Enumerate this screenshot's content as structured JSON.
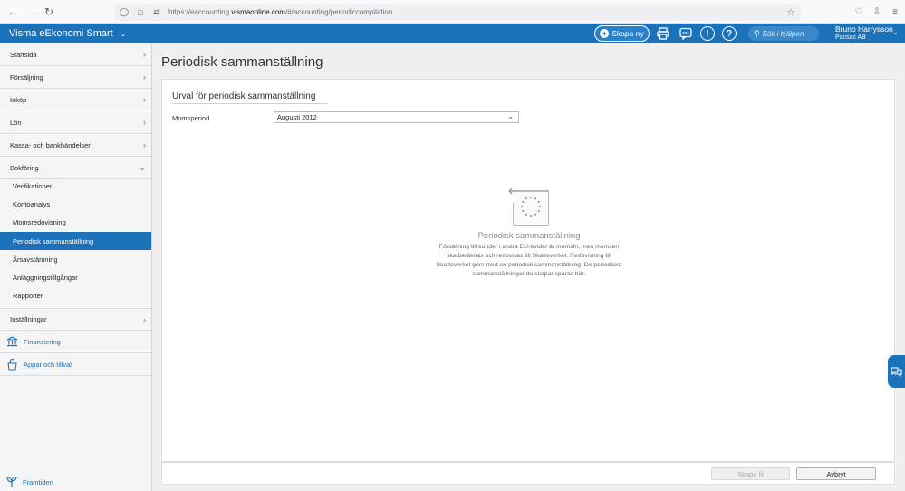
{
  "browser": {
    "url_prefix": "https://eaccounting.",
    "url_domain": "vismaonline.com",
    "url_path": "/#/accounting/periodiccompilation"
  },
  "header": {
    "app_name": "Visma eEkonomi Smart",
    "create_label": "Skapa ny",
    "search_placeholder": "Sök i hjälpen",
    "user_name": "Bruno Harrysson",
    "company": "Pacsac AB",
    "accent_color": "#1c72b9"
  },
  "sidebar": {
    "items": [
      {
        "label": "Startsida"
      },
      {
        "label": "Försäljning"
      },
      {
        "label": "Inköp"
      },
      {
        "label": "Lön"
      },
      {
        "label": "Kassa- och bankhändelser"
      },
      {
        "label": "Bokföring"
      }
    ],
    "sub_items": [
      {
        "label": "Verifikationer"
      },
      {
        "label": "Kontoanalys"
      },
      {
        "label": "Momsredovisning"
      },
      {
        "label": "Periodisk sammanställning"
      },
      {
        "label": "Årsavstämning"
      },
      {
        "label": "Anläggningstillgångar"
      },
      {
        "label": "Rapporter"
      }
    ],
    "settings_label": "Inställningar",
    "finance_label": "Finansiering",
    "apps_label": "Appar och tillval",
    "future_label": "Framtiden"
  },
  "main": {
    "page_title": "Periodisk sammanställning",
    "section_title": "Urval för periodisk sammanställning",
    "period_label": "Momsperiod",
    "period_value": "Augusti 2012",
    "empty_title": "Periodisk sammanställning",
    "empty_text": "Försäljning till kunder i andra EU-länder är momsfri, men momsen ska beräknas och redovisas till Skatteverket. Redovisning till Skatteverket görs med en periodisk sammanställning. De periodiska sammanställningar du skapar sparas här.",
    "create_file_label": "Skapa fil",
    "cancel_label": "Avbryt"
  }
}
